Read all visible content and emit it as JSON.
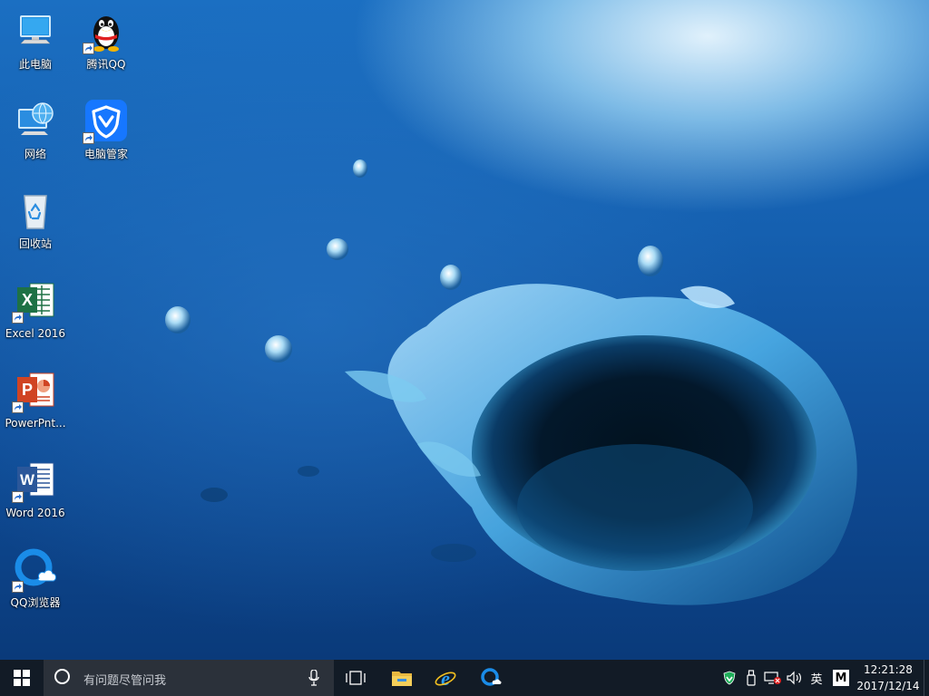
{
  "desktop": {
    "icons": [
      {
        "label": "此电脑",
        "icon": "this-pc-icon"
      },
      {
        "label": "网络",
        "icon": "network-icon"
      },
      {
        "label": "回收站",
        "icon": "recycle-bin-icon"
      },
      {
        "label": "Excel 2016",
        "icon": "excel-icon"
      },
      {
        "label": "PowerPnt...",
        "icon": "powerpoint-icon"
      },
      {
        "label": "Word 2016",
        "icon": "word-icon"
      },
      {
        "label": "QQ浏览器",
        "icon": "qq-browser-icon"
      },
      {
        "label": "腾讯QQ",
        "icon": "qq-penguin-icon"
      },
      {
        "label": "电脑管家",
        "icon": "pc-manager-icon"
      }
    ]
  },
  "taskbar": {
    "search_placeholder": "有问题尽管问我",
    "pinned": [
      "task-view-icon",
      "file-explorer-icon",
      "internet-explorer-icon",
      "qq-browser-icon"
    ],
    "tray": {
      "ime_label": "英",
      "ime_mode": "M"
    },
    "clock": {
      "time": "12:21:28",
      "date": "2017/12/14"
    }
  },
  "colors": {
    "taskbar_bg": "#121b26",
    "search_bg": "#2b313a",
    "excel_green": "#1e7145",
    "ppt_red": "#d04423",
    "word_blue": "#2b579a",
    "qq_blue": "#1a8ce8",
    "pc_manager_blue": "#1677ff"
  }
}
